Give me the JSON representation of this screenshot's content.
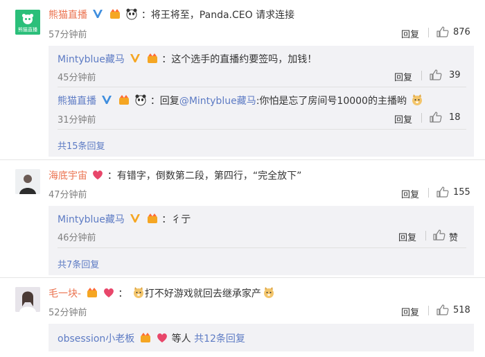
{
  "comments": [
    {
      "user": "熊猫直播",
      "text": "：将王将至，Panda.CEO 请求连接",
      "time": "57分钟前",
      "reply_label": "回复",
      "likes": "876",
      "avatar_text": "熊猫直播",
      "replies": [
        {
          "user": "Mintyblue藏马",
          "text": "：这个选手的直播约要签吗，加钱！",
          "time": "45分钟前",
          "reply_label": "回复",
          "likes": "39"
        },
        {
          "user": "熊猫直播",
          "text_prefix": "：回复",
          "mention": "@Mintyblue藏马",
          "text": ":你怕是忘了房间号10000的主播哟",
          "time": "31分钟前",
          "reply_label": "回复",
          "likes": "18"
        }
      ],
      "more": "共15条回复"
    },
    {
      "user": "海底宇宙",
      "text": "：有错字，倒数第二段，第四行，“完全放下”",
      "time": "47分钟前",
      "reply_label": "回复",
      "likes": "155",
      "replies": [
        {
          "user": "Mintyblue藏马",
          "text": "：彳亍",
          "time": "46分钟前",
          "reply_label": "回复",
          "likes": "赞"
        }
      ],
      "more": "共7条回复"
    },
    {
      "user": "毛一块-",
      "text": "打不好游戏就回去继承家产",
      "time": "52分钟前",
      "reply_label": "回复",
      "likes": "518",
      "replies": [
        {
          "user": "obsession小老板",
          "text": " 等人 ",
          "more_inline": "共12条回复"
        }
      ]
    }
  ],
  "colors": {
    "nickname": "#eb7350",
    "link": "#5d7bc4",
    "badge_gold": "#f5a623",
    "heart": "#e8466a"
  }
}
